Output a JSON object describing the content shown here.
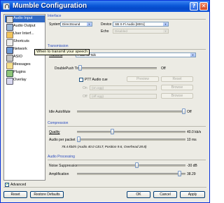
{
  "window": {
    "title": "Mumble Configuration",
    "help": "?",
    "close": "✕"
  },
  "sidebar": {
    "items": [
      {
        "label": "Audio Input",
        "icon": "microphone-icon",
        "selected": true
      },
      {
        "label": "Audio Output",
        "icon": "speaker-icon"
      },
      {
        "label": "User Interf...",
        "icon": "user-interface-icon"
      },
      {
        "label": "Shortcuts",
        "icon": "keyboard-icon"
      },
      {
        "label": "Network",
        "icon": "network-icon"
      },
      {
        "label": "ASIO",
        "icon": "asio-icon"
      },
      {
        "label": "Messages",
        "icon": "messages-icon"
      },
      {
        "label": "Plugins",
        "icon": "plugins-icon"
      },
      {
        "label": "Overlay",
        "icon": "overlay-icon"
      }
    ]
  },
  "interface": {
    "section": "Interface",
    "system_label": "System",
    "system_value": "DirectSound",
    "device_label": "Device",
    "device_value": "SB X-Fi Audio [8001]",
    "echo_label": "Echo",
    "echo_value": "Disabled"
  },
  "transmission": {
    "section": "Transmission",
    "transmit_label": "Transmit",
    "transmit_value": "Push To Talk",
    "doublepush_label": "DoublePush Time",
    "doublepush_value": "Off",
    "tooltip": "When to transmit your speech",
    "ptt_cue_label": "PTT Audio cue",
    "preview_label": "Preview",
    "reset_label": "Reset",
    "on_label": "On",
    "on_file": "(on.ogg)",
    "off_label": "Off",
    "off_file": "(off.ogg)",
    "browse_label": "Browse",
    "idle_label": "Idle AutoMute",
    "idle_value": "Off"
  },
  "compression": {
    "section": "Compression",
    "quality_label": "Quality",
    "quality_value": "40.0 kb/s",
    "app_label": "Audio per packet",
    "app_value": "10 ms",
    "bitrate_text": "78.4 kbit/s (Audio 40.0 CELT, Position 9.6, Overhead 28.8)"
  },
  "processing": {
    "section": "Audio Processing",
    "noise_label": "Noise Suppression",
    "noise_value": "-30 dB",
    "amp_label": "Amplification",
    "amp_value": "38.29"
  },
  "footer": {
    "advanced_label": "Advanced",
    "reset_label": "Reset",
    "restore_label": "Restore Defaults",
    "ok_label": "OK",
    "cancel_label": "Cancel",
    "apply_label": "Apply"
  },
  "slider_levels": {
    "doublepush": 0.0,
    "idle": 1.0,
    "quality": 0.32,
    "app": 0.0,
    "noise": 0.55,
    "amp": 0.96
  }
}
